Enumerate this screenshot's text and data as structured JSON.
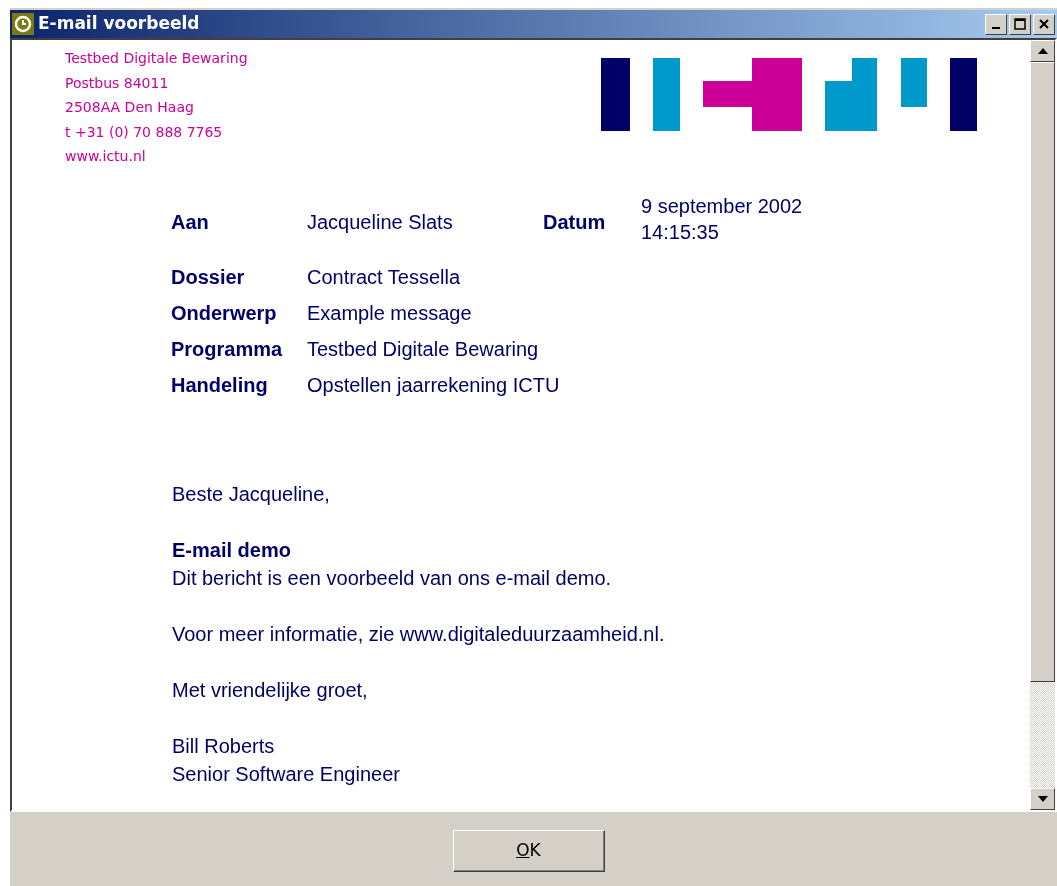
{
  "window": {
    "title": "E-mail voorbeeld"
  },
  "sender": [
    "Testbed Digitale Bewaring",
    "Postbus 84011",
    "2508AA Den Haag",
    "t +31 (0) 70 888 7765",
    "www.ictu.nl"
  ],
  "fields": [
    {
      "label": "Aan",
      "value": "Jacqueline Slats"
    },
    {
      "label": "Dossier",
      "value": "Contract Tessella"
    },
    {
      "label": "Onderwerp",
      "value": "Example message"
    },
    {
      "label": "Programma",
      "value": "Testbed Digitale Bewaring"
    },
    {
      "label": "Handeling",
      "value": "Opstellen jaarrekening ICTU"
    }
  ],
  "date": {
    "label": "Datum",
    "lines": [
      "9 september 2002",
      "14:15:35"
    ]
  },
  "body": [
    {
      "kind": "text",
      "lines": [
        "Beste Jacqueline,"
      ]
    },
    {
      "kind": "section",
      "heading": "E-mail demo",
      "lines": [
        "Dit bericht is een voorbeeld van ons e-mail demo."
      ]
    },
    {
      "kind": "text",
      "lines": [
        "Voor meer informatie, zie www.digitaleduurzaamheid.nl."
      ]
    },
    {
      "kind": "text",
      "lines": [
        "Met vriendelijke groet,"
      ]
    },
    {
      "kind": "text",
      "lines": [
        "Bill Roberts",
        "Senior Software Engineer"
      ]
    }
  ],
  "buttons": [
    "OK"
  ]
}
